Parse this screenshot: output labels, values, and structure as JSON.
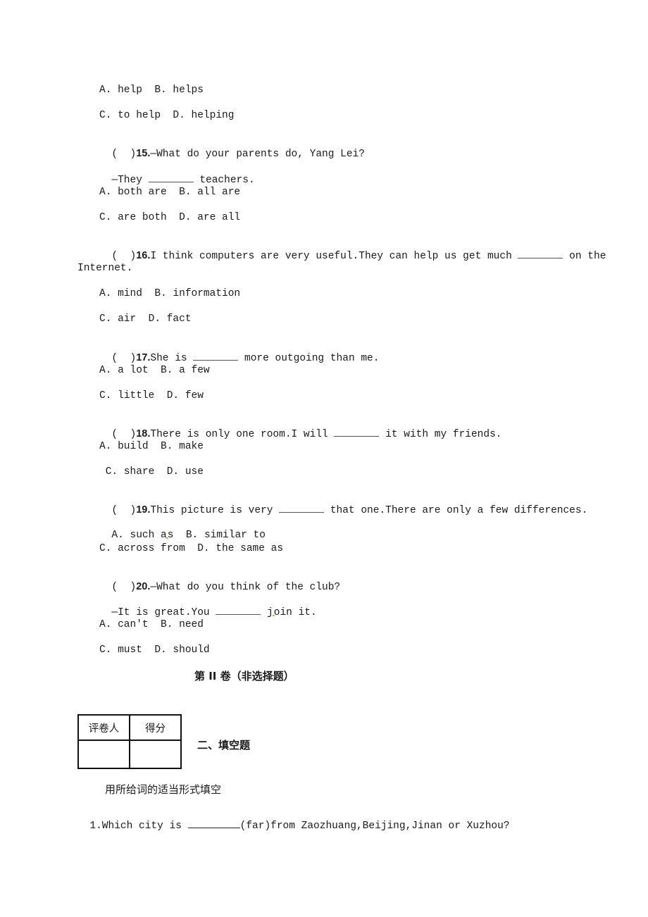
{
  "q14_options": {
    "ab": "A. help  B. helps",
    "cd": "C. to help  D. helping"
  },
  "questions": [
    {
      "number": "15.",
      "prefix": "(  )",
      "stem_before": "—What do your parents do, Yang Lei?",
      "line2_before": "—They ",
      "line2_after": " teachers.",
      "options_ab": "A. both are  B. all are",
      "options_cd": "C. are both  D. are all"
    },
    {
      "number": "16.",
      "prefix": "(  )",
      "stem_before": "I think computers are very useful.They can help us get much ",
      "stem_after": " on the",
      "continuation": "Internet.",
      "options_ab": "A. mind  B. information",
      "options_cd": "C. air  D. fact"
    },
    {
      "number": "17.",
      "prefix": "(  )",
      "stem_before": "She is ",
      "stem_after": " more outgoing than me.",
      "options_ab": "A. a lot  B. a few",
      "options_cd": "C. little  D. few"
    },
    {
      "number": "18.",
      "prefix": "(  )",
      "stem_before": "There is only one room.I will ",
      "stem_after": " it with my friends.",
      "options_ab": "A. build  B. make",
      "options_cd": " C. share  D. use"
    },
    {
      "number": "19.",
      "prefix": "(  )",
      "stem_before": "This picture is very ",
      "stem_after": " that one.There are only a few differences.",
      "options_ab_a": "A. such a",
      "options_ab_b": "s  B. similar to",
      "options_cd": "C. across from  D. the same as"
    },
    {
      "number": "20.",
      "prefix": "(  )",
      "stem_before": "—What do you think of the club?",
      "line2_before": "—It is great.You ",
      "line2_after_a": " j",
      "line2_after_b": "oin it.",
      "options_ab": "A. can't  B. need",
      "options_cd": "C. must  D. should"
    }
  ],
  "part2": {
    "title": "第 II 卷（非选择题）",
    "score_table": {
      "headers": [
        "评卷人",
        "得分"
      ]
    },
    "section_heading": "二、填空题",
    "instruction": "用所给词的适当形式填空",
    "fill_q1_before": "1.Which city is ",
    "fill_q1_after": "(far)from Zaozhuang,Beijing,Jinan or Xuzhou?"
  }
}
